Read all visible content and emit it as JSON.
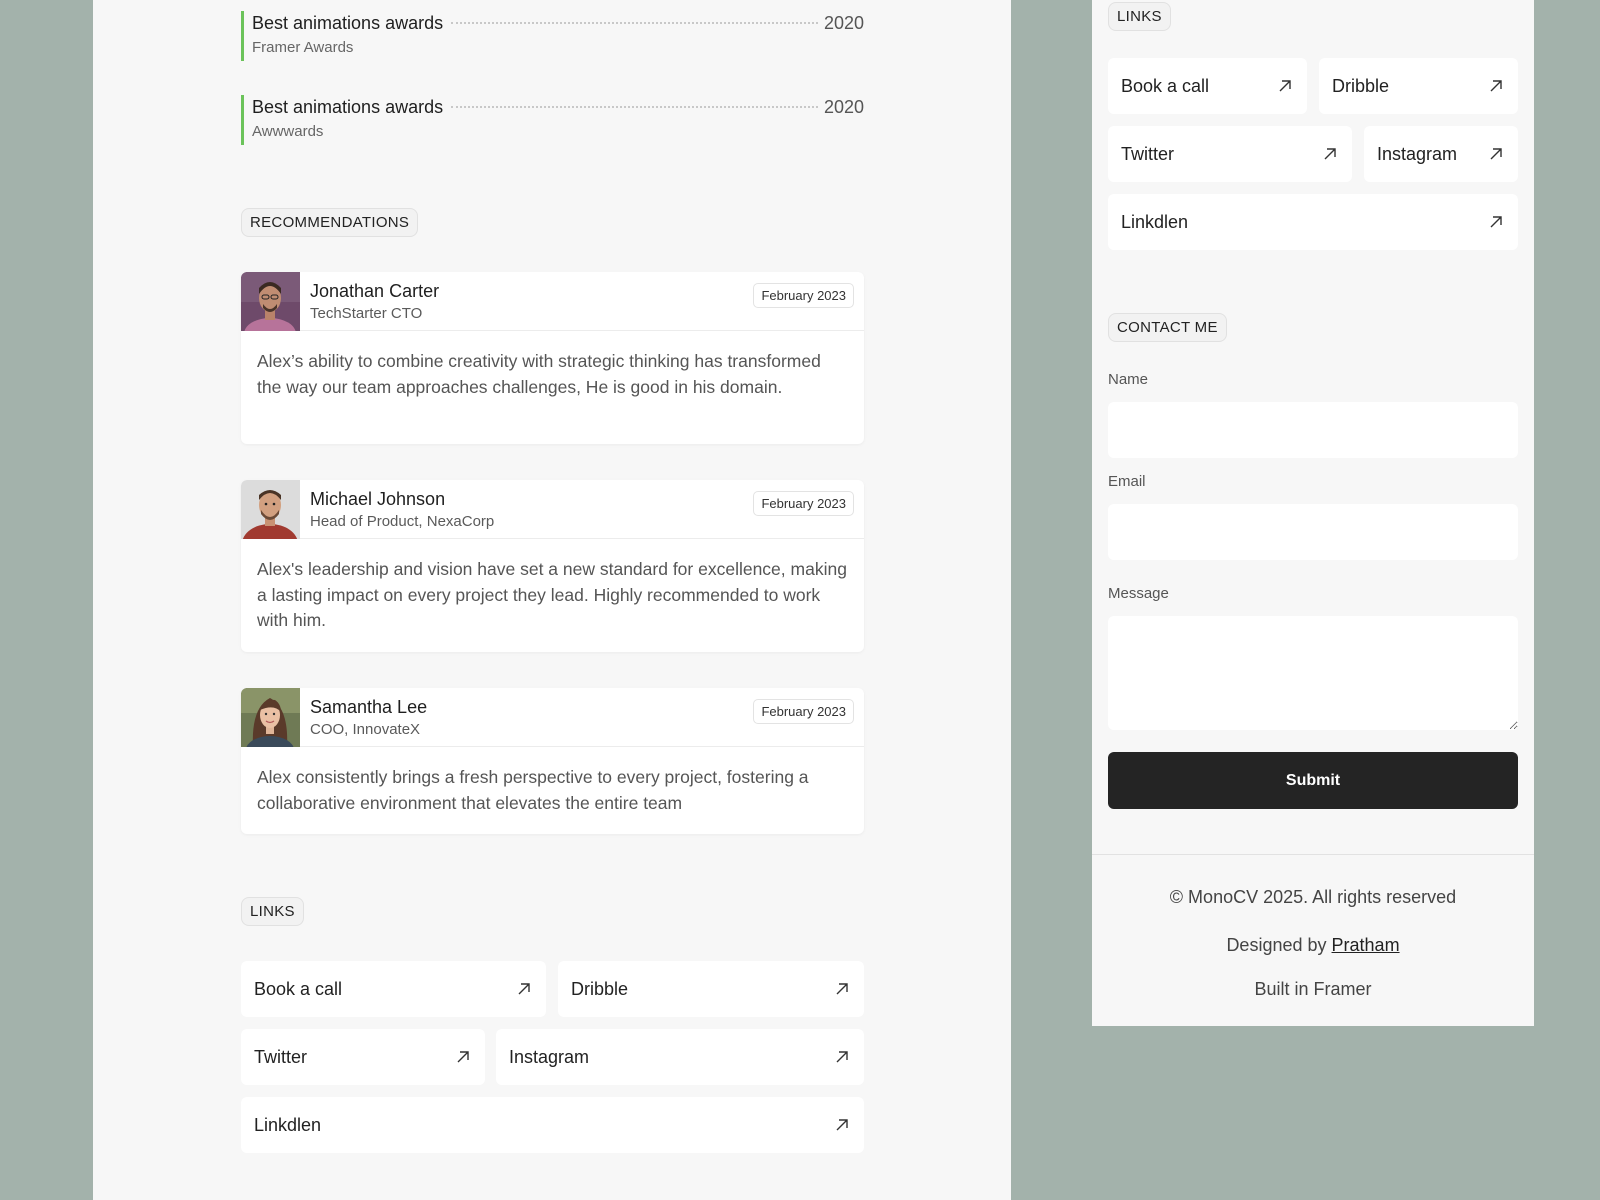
{
  "awards": [
    {
      "title": "Best animations awards",
      "org": "Framer Awards",
      "year": "2020"
    },
    {
      "title": "Best animations awards",
      "org": "Awwwards",
      "year": "2020"
    }
  ],
  "recommendations": {
    "heading": "RECOMMENDATIONS",
    "items": [
      {
        "name": "Jonathan Carter",
        "role": "TechStarter CTO",
        "date": "February 2023",
        "text": "Alex’s ability to combine creativity with strategic thinking has transformed the way our team approaches challenges, He is good in his domain."
      },
      {
        "name": "Michael Johnson",
        "role": "Head of Product, NexaCorp",
        "date": "February 2023",
        "text": "Alex's leadership and vision have set a new standard for excellence, making a lasting impact on every project they lead. Highly recommended to work with him."
      },
      {
        "name": "Samantha Lee",
        "role": "COO, InnovateX",
        "date": "February 2023",
        "text": "Alex consistently brings a fresh perspective to every project, fostering a collaborative environment that elevates the entire team"
      }
    ]
  },
  "links": {
    "heading": "LINKS",
    "items": [
      {
        "label": "Book a call",
        "icon": "arrow-up-right-icon"
      },
      {
        "label": "Dribble",
        "icon": "arrow-up-right-icon"
      },
      {
        "label": "Twitter",
        "icon": "arrow-up-right-icon"
      },
      {
        "label": "Instagram",
        "icon": "arrow-up-right-icon"
      },
      {
        "label": "Linkdlen",
        "icon": "arrow-up-right-icon"
      }
    ]
  },
  "contact": {
    "heading": "CONTACT ME",
    "name_label": "Name",
    "name_value": "",
    "email_label": "Email",
    "email_value": "",
    "message_label": "Message",
    "message_value": "",
    "submit_label": "Submit"
  },
  "footer": {
    "copyright": "© MonoCV 2025. All rights reserved",
    "designed_prefix": "Designed by",
    "designer": "Pratham",
    "built": "Built in Framer"
  },
  "colors": {
    "background": "#a3b2ab",
    "panel": "#f7f7f7",
    "award_accent": "#6bc35a",
    "submit_button": "#242424"
  }
}
